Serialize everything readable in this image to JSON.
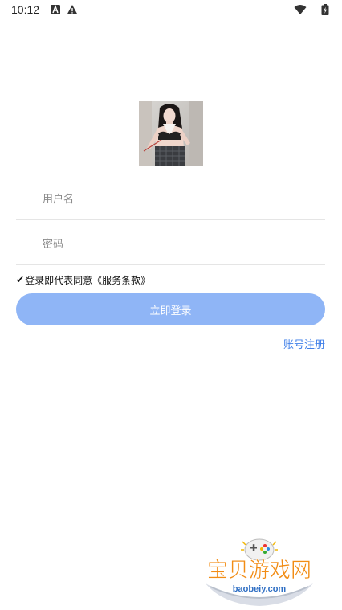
{
  "status_bar": {
    "time": "10:12",
    "icons_left": [
      "a-box-icon",
      "warning-icon"
    ],
    "icons_right": [
      "wifi-icon",
      "battery-icon"
    ]
  },
  "form": {
    "username": {
      "placeholder": "用户名",
      "value": ""
    },
    "password": {
      "placeholder": "密码",
      "value": ""
    },
    "agreement_check": "✔",
    "agreement_text": "登录即代表同意《服务条款》",
    "login_label": "立即登录",
    "register_label": "账号注册"
  },
  "watermark": {
    "brand": "宝贝游戏网",
    "url": "baobeiy.com"
  },
  "colors": {
    "primary": "#8fb5f6",
    "link": "#3f7fe8",
    "divider": "#e5e5e5",
    "watermark_orange": "#f28c14"
  }
}
